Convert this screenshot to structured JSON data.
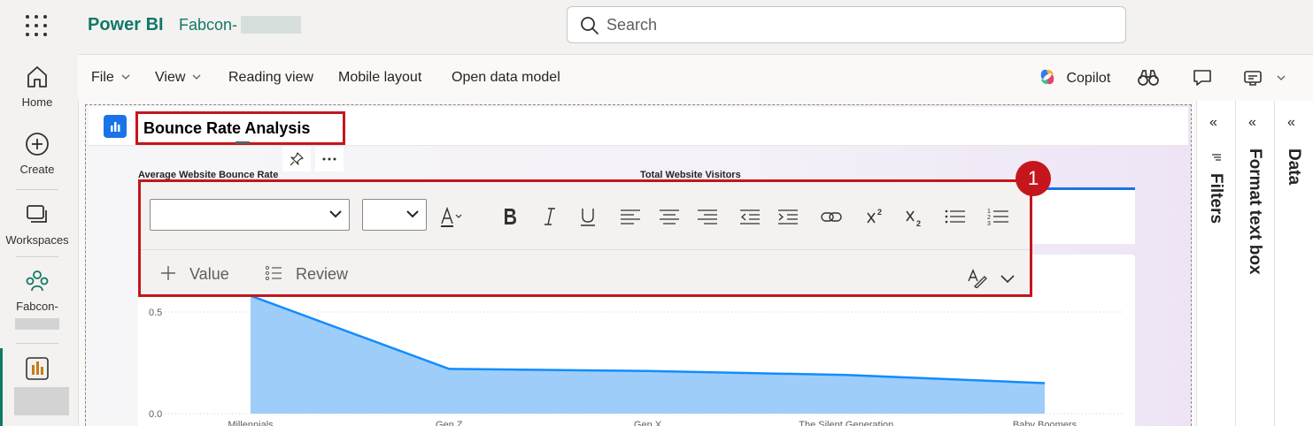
{
  "app": {
    "brand": "Power BI",
    "workspace": "Fabcon-"
  },
  "search": {
    "placeholder": "Search"
  },
  "nav": {
    "items": [
      {
        "label": "Home"
      },
      {
        "label": "Create"
      },
      {
        "label": "Workspaces"
      },
      {
        "label": "Fabcon-"
      }
    ]
  },
  "toolbar": {
    "file": "File",
    "view": "View",
    "reading_view": "Reading view",
    "mobile_layout": "Mobile layout",
    "open_data_model": "Open data model",
    "copilot": "Copilot"
  },
  "report": {
    "title": "Bounce Rate Analysis",
    "visual1_title": "Average Website Bounce Rate",
    "visual2_title": "Total Website Visitors"
  },
  "format_popup": {
    "font_family": "",
    "font_size": "",
    "value_button": "Value",
    "review_button": "Review"
  },
  "step_badge": "1",
  "panes": {
    "filters": "Filters",
    "format": "Format text box",
    "data": "Data"
  },
  "chart_data": {
    "type": "area",
    "categories": [
      "Millennials",
      "Gen Z",
      "Gen X",
      "The Silent Generation",
      "Baby Boomers"
    ],
    "values": [
      0.58,
      0.22,
      0.21,
      0.19,
      0.15
    ],
    "y_ticks": [
      "0.0",
      "0.5"
    ],
    "ylim": [
      0,
      0.6
    ],
    "color": "#118dff",
    "fill": "#9fcdfa",
    "grid": true
  }
}
